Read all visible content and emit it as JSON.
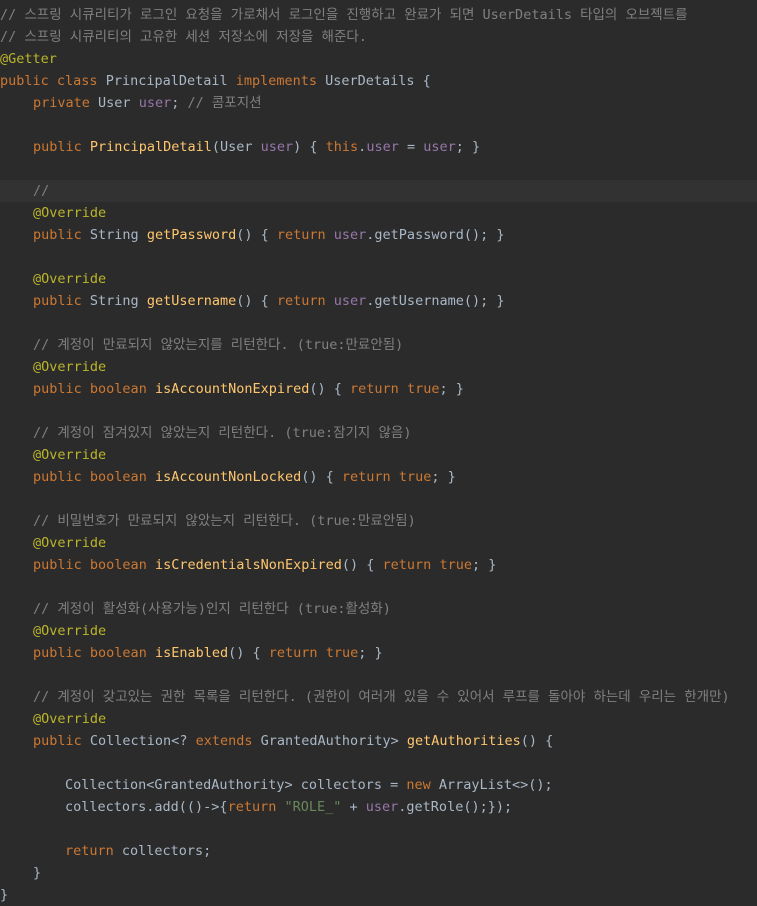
{
  "editor": {
    "lines": [
      "// 스프링 시큐리티가 로그인 요청을 가로채서 로그인을 진행하고 완료가 되면 UserDetails 타입의 오브젝트를",
      "// 스프링 시큐리티의 고유한 세션 저장소에 저장을 해준다.",
      "@Getter",
      "public class PrincipalDetail implements UserDetails {",
      "private User user; // 콤포지션",
      "",
      "public PrincipalDetail(User user) { this.user = user; }",
      "",
      "//",
      "@Override",
      "public String getPassword() { return user.getPassword(); }",
      "",
      "@Override",
      "public String getUsername() { return user.getUsername(); }",
      "",
      "// 계정이 만료되지 않았는지를 리턴한다. (true:만료안됨)",
      "@Override",
      "public boolean isAccountNonExpired() { return true; }",
      "",
      "// 계정이 잠겨있지 않았는지 리턴한다. (true:잠기지 않음)",
      "@Override",
      "public boolean isAccountNonLocked() { return true; }",
      "",
      "// 비밀번호가 만료되지 않았는지 리턴한다. (true:만료안됨)",
      "@Override",
      "public boolean isCredentialsNonExpired() { return true; }",
      "",
      "// 계정이 활성화(사용가능)인지 리턴한다 (true:활성화)",
      "@Override",
      "public boolean isEnabled() { return true; }",
      "",
      "// 계정이 갖고있는 권한 목록을 리턴한다. (권한이 여러개 있을 수 있어서 루프를 돌아야 하는데 우리는 한개만)",
      "@Override",
      "public Collection<? extends GrantedAuthority> getAuthorities() {",
      "",
      "Collection<GrantedAuthority> collectors = new ArrayList<>();",
      "collectors.add(()->{return \"ROLE_\" + user.getRole();});",
      "",
      "return collectors;",
      "}",
      "}"
    ]
  },
  "colors": {
    "background": "#2b2b2b",
    "current_line": "#323232",
    "keyword": "#cc7832",
    "annotation": "#bbb529",
    "comment": "#808080",
    "method": "#ffc66d",
    "field": "#9876aa",
    "string": "#6a8759",
    "default_text": "#a9b7c6"
  }
}
